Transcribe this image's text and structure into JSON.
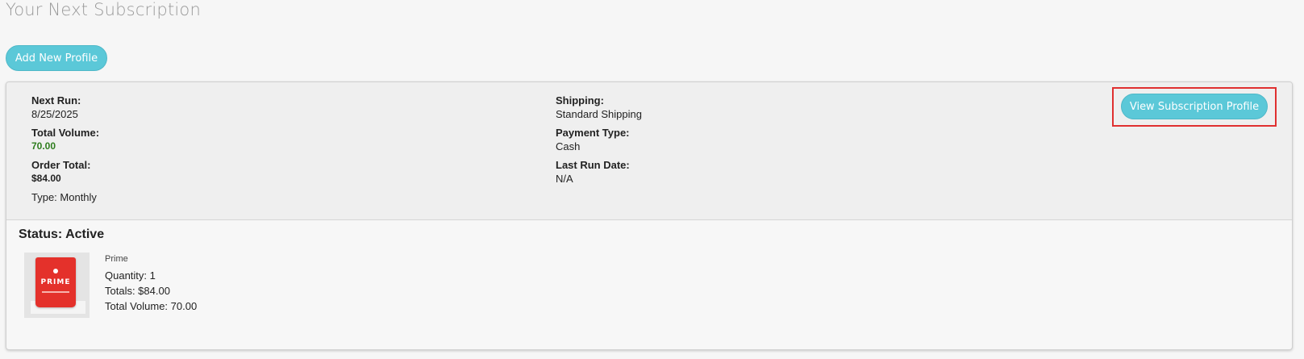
{
  "page": {
    "title": "Your Next Subscription"
  },
  "actions": {
    "add_profile_label": "Add New Profile"
  },
  "subscription": {
    "next_run_label": "Next Run:",
    "next_run_value": "8/25/2025",
    "total_volume_label": "Total Volume:",
    "total_volume_value": "70.00",
    "order_total_label": "Order Total:",
    "order_total_value": "$84.00",
    "type_text": "Type: Monthly",
    "shipping_label": "Shipping:",
    "shipping_value": "Standard Shipping",
    "payment_type_label": "Payment Type:",
    "payment_type_value": "Cash",
    "last_run_label": "Last Run Date:",
    "last_run_value": "N/A",
    "view_profile_label": "View Subscription Profile",
    "status_text": "Status: Active",
    "product": {
      "name": "Prime",
      "image_text": "PRIME",
      "quantity": "Quantity: 1",
      "totals": "Totals: $84.00",
      "total_volume": "Total Volume: 70.00"
    }
  },
  "colors": {
    "accent": "#5bc8d8",
    "volume_green": "#2e7d1e",
    "highlight_red": "#e03030",
    "product_red": "#e4312b"
  }
}
